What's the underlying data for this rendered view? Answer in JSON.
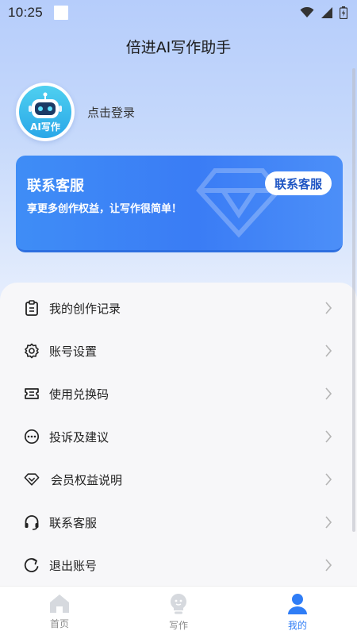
{
  "status_bar": {
    "time": "10:25"
  },
  "header": {
    "title": "倍进AI写作助手"
  },
  "profile": {
    "avatar_text": "AI写作",
    "login_text": "点击登录"
  },
  "vip_card": {
    "title": "联系客服",
    "subtitle": "享更多创作权益，让写作很简单！",
    "button_label": "联系客服"
  },
  "menu": {
    "items": [
      {
        "label": "我的创作记录",
        "icon": "clipboard-icon"
      },
      {
        "label": "账号设置",
        "icon": "gear-icon"
      },
      {
        "label": "使用兑换码",
        "icon": "ticket-icon"
      },
      {
        "label": "投诉及建议",
        "icon": "chat-dots-icon"
      },
      {
        "label": "会员权益说明",
        "icon": "diamond-icon"
      },
      {
        "label": "联系客服",
        "icon": "headset-icon"
      },
      {
        "label": "退出账号",
        "icon": "logout-icon"
      }
    ]
  },
  "tab_bar": {
    "tabs": [
      {
        "label": "首页",
        "icon": "home-icon",
        "active": false
      },
      {
        "label": "写作",
        "icon": "lightbulb-icon",
        "active": false
      },
      {
        "label": "我的",
        "icon": "user-icon",
        "active": true
      }
    ]
  },
  "colors": {
    "accent": "#2f7df6",
    "card_blue": "#3a7cf5",
    "header_bg": "#b6cdfb",
    "inactive_tab": "#8b8b8b"
  }
}
